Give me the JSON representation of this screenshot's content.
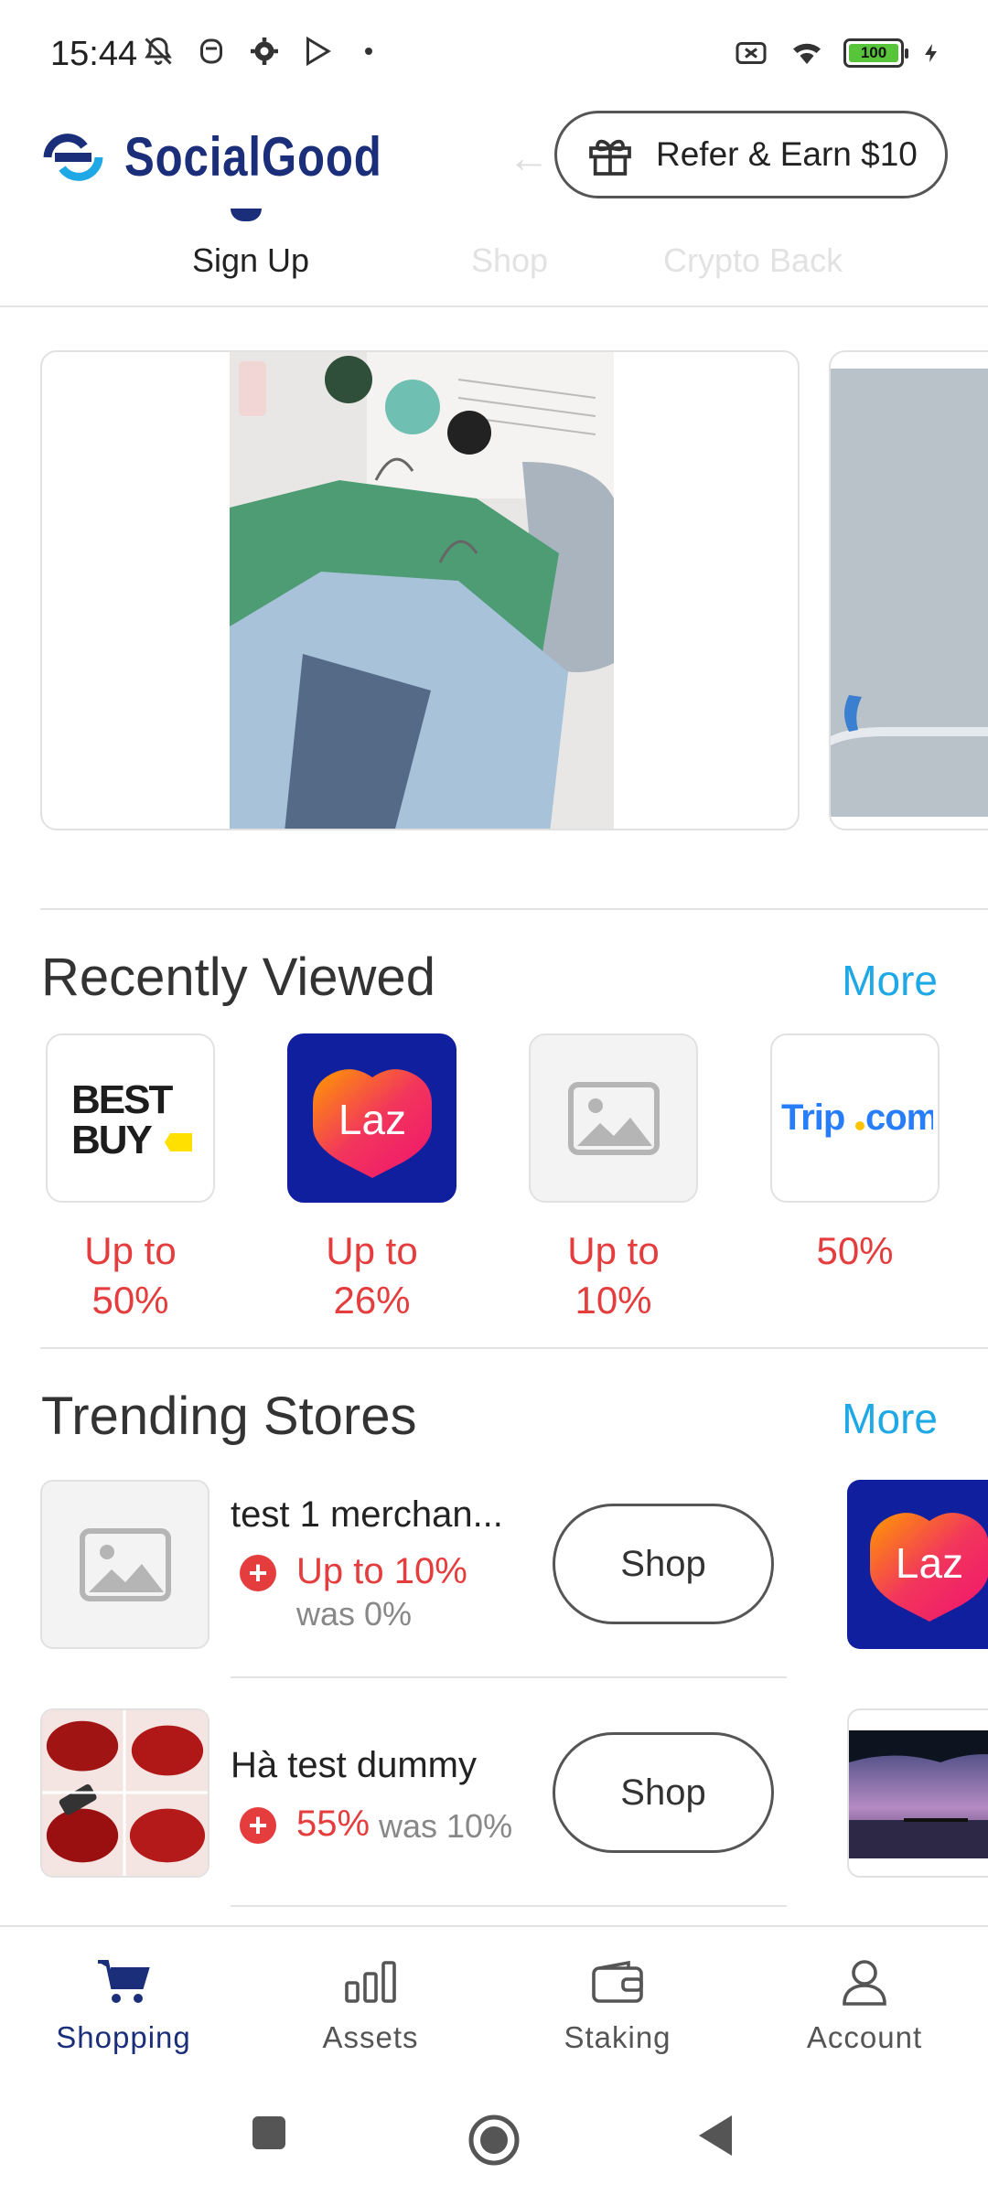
{
  "status_bar": {
    "time": "15:44",
    "battery": "100",
    "icons_left": [
      "bell-off-icon",
      "face-icon",
      "gear-icon",
      "play-store-icon"
    ],
    "icons_right": [
      "no-sim-icon",
      "wifi-icon",
      "battery-icon",
      "charging-icon"
    ]
  },
  "header": {
    "logo_text": "SocialGood",
    "refer_label": "Refer & Earn $10"
  },
  "tabs": [
    {
      "label": "Sign Up"
    },
    {
      "label": "Shop"
    },
    {
      "label": "Crypto Back"
    }
  ],
  "recently_viewed": {
    "title": "Recently Viewed",
    "more": "More",
    "items": [
      {
        "logo": "BEST BUY",
        "label_line1": "Up to",
        "label_line2": "50%"
      },
      {
        "logo": "Laz",
        "label_line1": "Up to",
        "label_line2": "26%"
      },
      {
        "logo": "placeholder-image",
        "label_line1": "Up to",
        "label_line2": "10%"
      },
      {
        "logo": "Trip.com",
        "label_line1": "50%",
        "label_line2": ""
      }
    ]
  },
  "trending": {
    "title": "Trending Stores",
    "more": "More",
    "items": [
      {
        "name": "test 1 merchan...",
        "rate": "Up to 10%",
        "was": "was 0%",
        "shop": "Shop"
      },
      {
        "name": "Hà test dummy",
        "rate": "55%",
        "was": "was 10%",
        "shop": "Shop"
      }
    ]
  },
  "bottom_nav": [
    {
      "label": "Shopping",
      "icon": "cart-icon",
      "active": true
    },
    {
      "label": "Assets",
      "icon": "bar-chart-icon",
      "active": false
    },
    {
      "label": "Staking",
      "icon": "wallet-icon",
      "active": false
    },
    {
      "label": "Account",
      "icon": "person-icon",
      "active": false
    }
  ],
  "colors": {
    "brand": "#1a2e7a",
    "accent": "#1fa8e6",
    "rate": "#e53d3d"
  }
}
